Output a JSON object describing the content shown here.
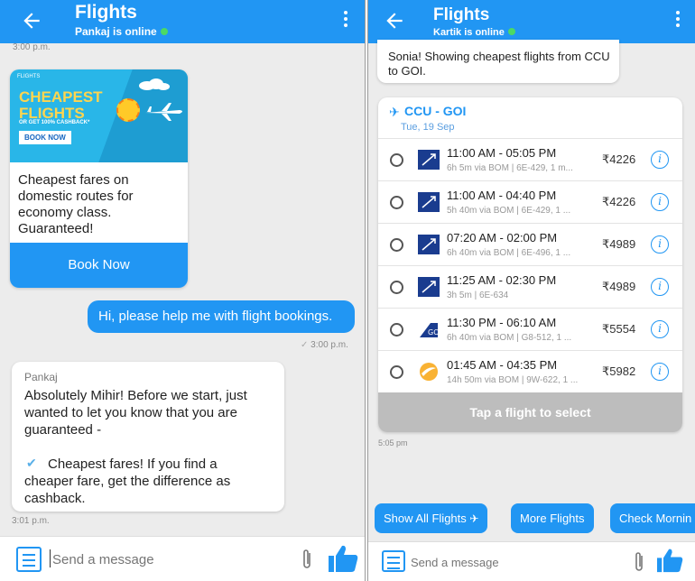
{
  "left": {
    "header": {
      "title": "Flights",
      "status": "Pankaj is online"
    },
    "messages": {
      "timestamp_top": "3:00 p.m.",
      "promo": {
        "image_small": "FLIGHTS",
        "image_line1": "CHEAPEST",
        "image_line2": "FLIGHTS",
        "image_cashback": "OR GET 100% CASHBACK*",
        "image_button": "BOOK NOW",
        "text": "Cheapest fares on domestic routes for economy class. Guaranteed!",
        "button": "Book Now"
      },
      "outgoing": {
        "text": "Hi, please help me with flight bookings.",
        "time": "3:00 p.m."
      },
      "incoming": {
        "sender": "Pankaj",
        "text": "Absolutely Mihir! Before we start, just wanted to let you know that you are guaranteed -",
        "point": "Cheapest fares! If you find a cheaper fare, get the difference as cashback.",
        "time": "3:01 p.m."
      }
    },
    "composer": {
      "placeholder": "Send a message"
    }
  },
  "right": {
    "header": {
      "title": "Flights",
      "status": "Kartik is online"
    },
    "intro_message": "Sonia! Showing cheapest flights from CCU to GOI.",
    "route": {
      "name": "CCU - GOI",
      "date": "Tue, 19 Sep"
    },
    "flights": [
      {
        "time": "11:00 AM - 05:05 PM",
        "detail": "6h 5m via BOM | 6E-429, 1 m...",
        "price": "₹4226",
        "airline": "indigo"
      },
      {
        "time": "11:00 AM - 04:40 PM",
        "detail": "5h 40m via BOM | 6E-429, 1 ...",
        "price": "₹4226",
        "airline": "indigo"
      },
      {
        "time": "07:20 AM - 02:00 PM",
        "detail": "6h 40m via BOM | 6E-496, 1 ...",
        "price": "₹4989",
        "airline": "indigo"
      },
      {
        "time": "11:25 AM - 02:30 PM",
        "detail": "3h 5m | 6E-634",
        "price": "₹4989",
        "airline": "indigo"
      },
      {
        "time": "11:30 PM - 06:10 AM",
        "detail": "6h 40m via BOM | G8-512, 1 ...",
        "price": "₹5554",
        "airline": "goair"
      },
      {
        "time": "01:45 AM - 04:35 PM",
        "detail": "14h 50m via BOM | 9W-622, 1 ...",
        "price": "₹5982",
        "airline": "jetairways"
      }
    ],
    "select_prompt": "Tap a flight to select",
    "list_time": "5:05 pm",
    "chips": [
      "Show All Flights",
      "More Flights",
      "Check Mornin"
    ],
    "composer": {
      "placeholder": "Send a message"
    }
  },
  "colors": {
    "primary": "#2196f3",
    "online": "#4cd964",
    "disabled": "#bdbdbd"
  }
}
